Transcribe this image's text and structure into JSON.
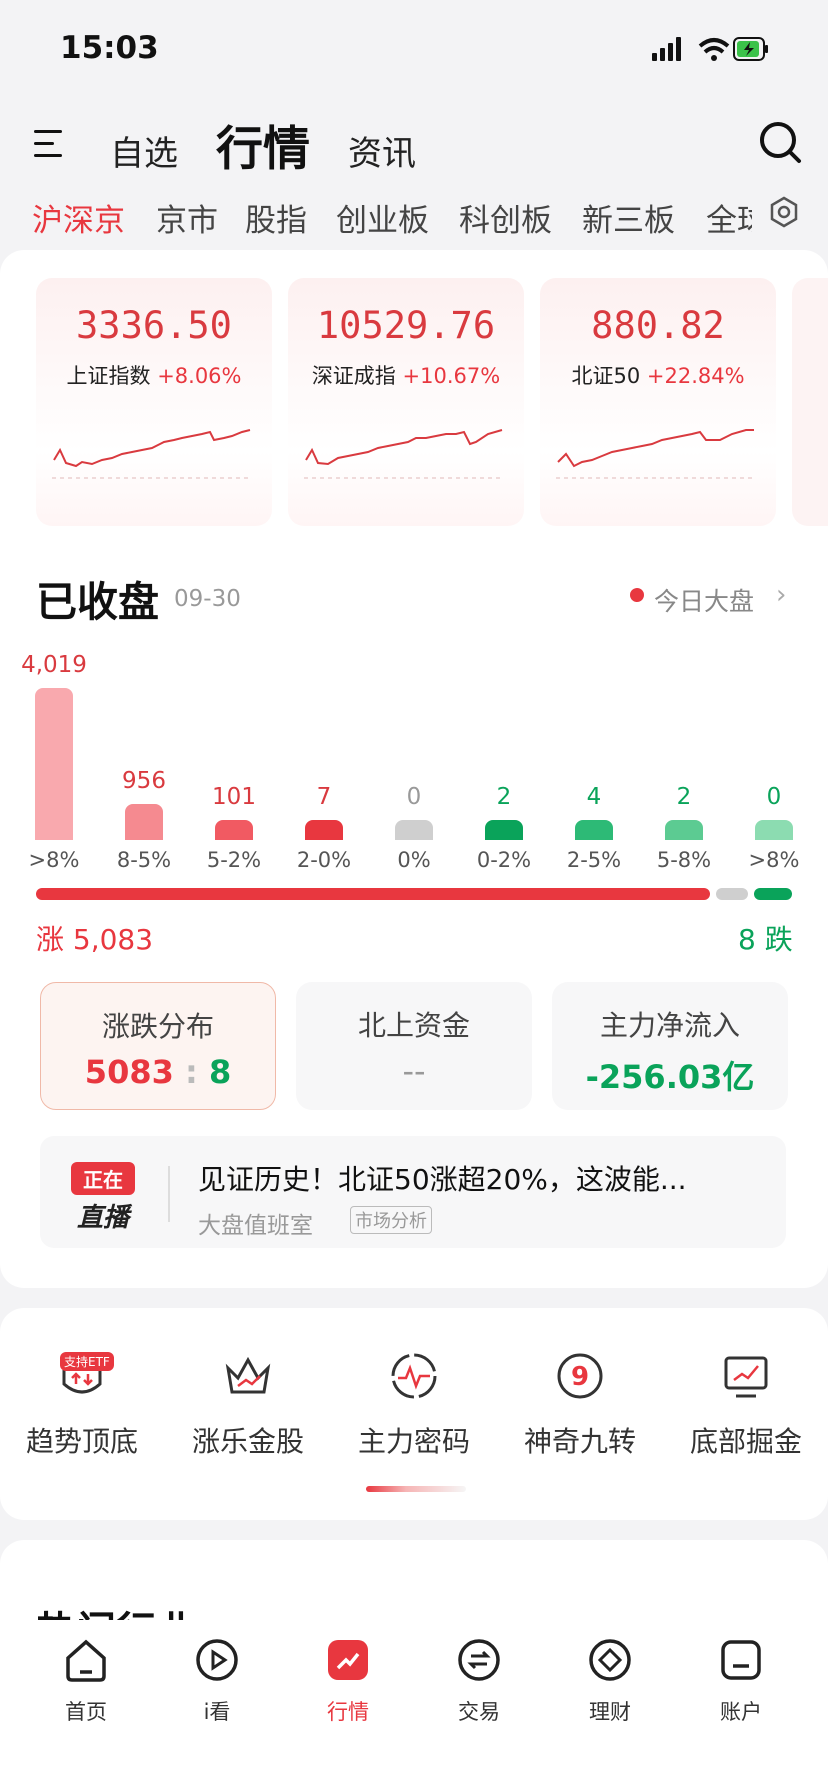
{
  "status": {
    "time": "15:03"
  },
  "nav": {
    "tabs": [
      "自选",
      "行情",
      "资讯"
    ],
    "active": "行情"
  },
  "market_tabs": [
    "沪深京",
    "京市",
    "股指",
    "创业板",
    "科创板",
    "新三板",
    "全球"
  ],
  "indices": [
    {
      "value": "3336.50",
      "name": "上证指数",
      "change": "+8.06%"
    },
    {
      "value": "10529.76",
      "name": "深证成指",
      "change": "+10.67%"
    },
    {
      "value": "880.82",
      "name": "北证50",
      "change": "+22.84%"
    }
  ],
  "section": {
    "title": "已收盘",
    "date": "09-30",
    "today_label": "今日大盘"
  },
  "distribution": {
    "counts": [
      "4,019",
      "956",
      "101",
      "7",
      "0",
      "2",
      "4",
      "2",
      "0"
    ],
    "labels": [
      ">8%",
      "8-5%",
      "5-2%",
      "2-0%",
      "0%",
      "0-2%",
      "2-5%",
      "5-8%",
      ">8%"
    ],
    "rise_label": "涨 5,083",
    "fall_label": "8 跌",
    "colors": {
      "rise": "#e8373f",
      "flat": "#cfcfcf",
      "fall": "#0aa35a"
    }
  },
  "stats": {
    "dist_title": "涨跌分布",
    "dist_up": "5083",
    "dist_sep": ":",
    "dist_down": "8",
    "north_title": "北上资金",
    "north_value": "--",
    "main_title": "主力净流入",
    "main_value": "-256.03亿"
  },
  "live": {
    "badge_top": "正在",
    "badge_bottom": "直播",
    "headline": "见证历史！北证50涨超20%，这波能...",
    "source": "大盘值班室",
    "tag": "市场分析"
  },
  "tools": [
    {
      "label": "趋势顶底",
      "badge": "支持ETF",
      "icon": "shield-icon"
    },
    {
      "label": "涨乐金股",
      "icon": "crown-icon"
    },
    {
      "label": "主力密码",
      "icon": "pulse-icon"
    },
    {
      "label": "神奇九转",
      "icon": "nine-icon"
    },
    {
      "label": "底部掘金",
      "icon": "monitor-icon"
    }
  ],
  "partial_heading": "热门行业",
  "tabbar": [
    "首页",
    "i看",
    "行情",
    "交易",
    "理财",
    "账户"
  ],
  "tabbar_active": "行情"
}
